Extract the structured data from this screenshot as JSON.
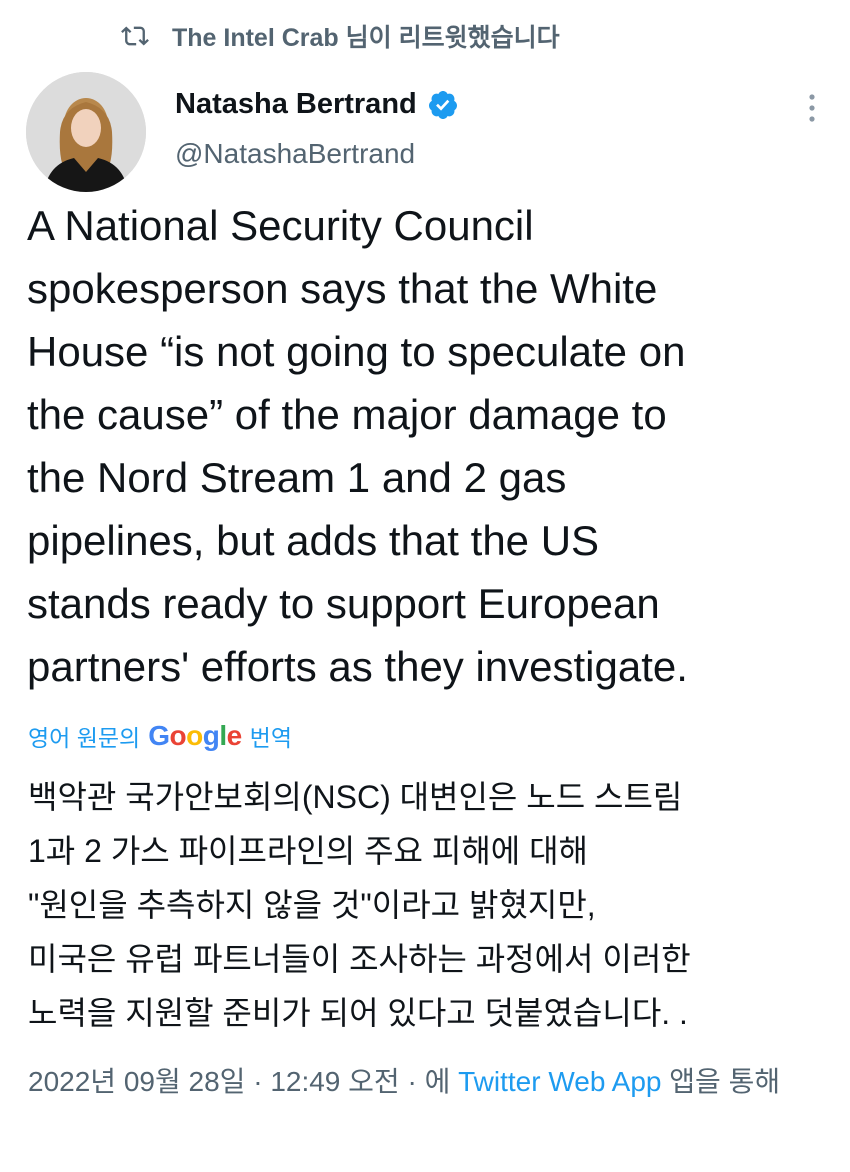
{
  "retweet": {
    "text": "The Intel Crab 님이 리트윗했습니다"
  },
  "author": {
    "display_name": "Natasha Bertrand",
    "handle": "@NatashaBertrand",
    "verified": true
  },
  "tweet": {
    "text": "A National Security Council\nspokesperson says that the White\nHouse “is not going to speculate on\nthe cause” of the major damage to\nthe Nord Stream 1 and 2 gas\npipelines, but adds that the US\nstands ready to support European\npartners' efforts as they investigate."
  },
  "translation": {
    "prefix": "영어 원문의",
    "provider": "Google",
    "suffix": "번역",
    "text": "백악관 국가안보회의(NSC) 대변인은 노드 스트림\n1과 2 가스 파이프라인의 주요 피해에 대해\n\"원인을 추측하지 않을 것\"이라고 밝혔지만,\n미국은 유럽 파트너들이 조사하는 과정에서 이러한\n노력을 지원할 준비가 되어 있다고 덧붙였습니다. ."
  },
  "meta": {
    "date": "2022년 09월 28일",
    "separator1": " · ",
    "time": "12:49 오전",
    "separator2": " · ",
    "via_prefix": "에 ",
    "source": "Twitter Web App",
    "via_suffix": " 앱을 통해"
  },
  "colors": {
    "accent": "#1d9bf0",
    "secondary_text": "#536471",
    "primary_text": "#0f1419"
  },
  "icons": {
    "retweet": "retweet-icon",
    "verified": "verified-badge-icon",
    "more": "more-options-icon",
    "avatar": "profile-avatar"
  }
}
